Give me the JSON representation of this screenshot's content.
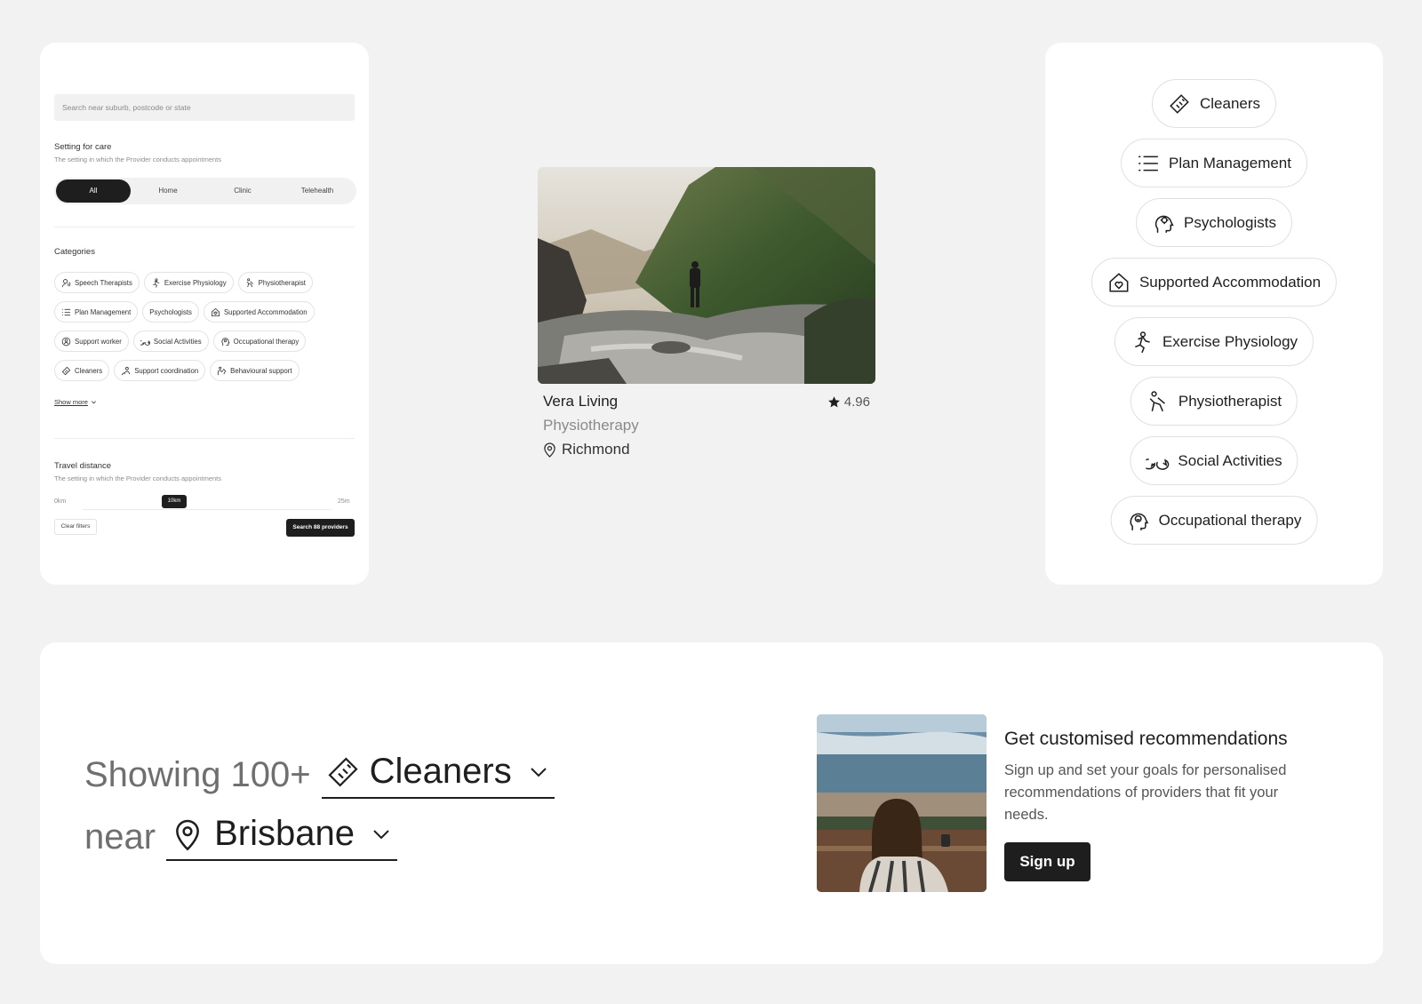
{
  "filters": {
    "search_placeholder": "Search near suburb, postcode or state",
    "setting_title": "Setting for care",
    "setting_sub": "The setting in which the Provider conducts appointments",
    "setting_options": [
      "All",
      "Home",
      "Clinic",
      "Telehealth"
    ],
    "setting_selected": "All",
    "categories_title": "Categories",
    "categories": [
      {
        "label": "Speech Therapists",
        "icon": "speech-therapist-icon"
      },
      {
        "label": "Exercise Physiology",
        "icon": "exercise-icon"
      },
      {
        "label": "Physiotherapist",
        "icon": "physio-icon"
      },
      {
        "label": "Plan Management",
        "icon": "list-icon"
      },
      {
        "label": "Psychologists",
        "icon": ""
      },
      {
        "label": "Supported Accommodation",
        "icon": "home-heart-icon"
      },
      {
        "label": "Support worker",
        "icon": "support-worker-icon"
      },
      {
        "label": "Social Activities",
        "icon": "chat-icon"
      },
      {
        "label": "Occupational therapy",
        "icon": "head-icon"
      },
      {
        "label": "Cleaners",
        "icon": "brush-icon"
      },
      {
        "label": "Support coordination",
        "icon": "coordination-icon"
      },
      {
        "label": "Behavioural support",
        "icon": "behaviour-icon"
      }
    ],
    "show_more": "Show more",
    "travel_title": "Travel distance",
    "travel_sub": "The setting in which the Provider conducts appointments",
    "travel_min": "0km",
    "travel_value": "10km",
    "travel_max": "25m",
    "clear_label": "Clear filters",
    "search_label": "Search 88 providers"
  },
  "listing": {
    "name": "Vera Living",
    "rating": "4.96",
    "type": "Physiotherapy",
    "location": "Richmond"
  },
  "category_pills": [
    {
      "label": "Cleaners",
      "icon": "brush-icon"
    },
    {
      "label": "Plan Management",
      "icon": "list-icon"
    },
    {
      "label": "Psychologists",
      "icon": "brain-gear-icon"
    },
    {
      "label": "Supported Accommodation",
      "icon": "home-heart-icon"
    },
    {
      "label": "Exercise Physiology",
      "icon": "exercise-icon"
    },
    {
      "label": "Physiotherapist",
      "icon": "physio-icon"
    },
    {
      "label": "Social Activities",
      "icon": "chat-icon"
    },
    {
      "label": "Occupational therapy",
      "icon": "head-icon"
    }
  ],
  "banner": {
    "showing_prefix": "Showing 100+",
    "category": "Cleaners",
    "near_label": "near",
    "location": "Brisbane",
    "rec_title": "Get customised recommendations",
    "rec_body": "Sign up and set your goals for personalised recommendations of providers that fit your needs.",
    "signup_label": "Sign up"
  }
}
